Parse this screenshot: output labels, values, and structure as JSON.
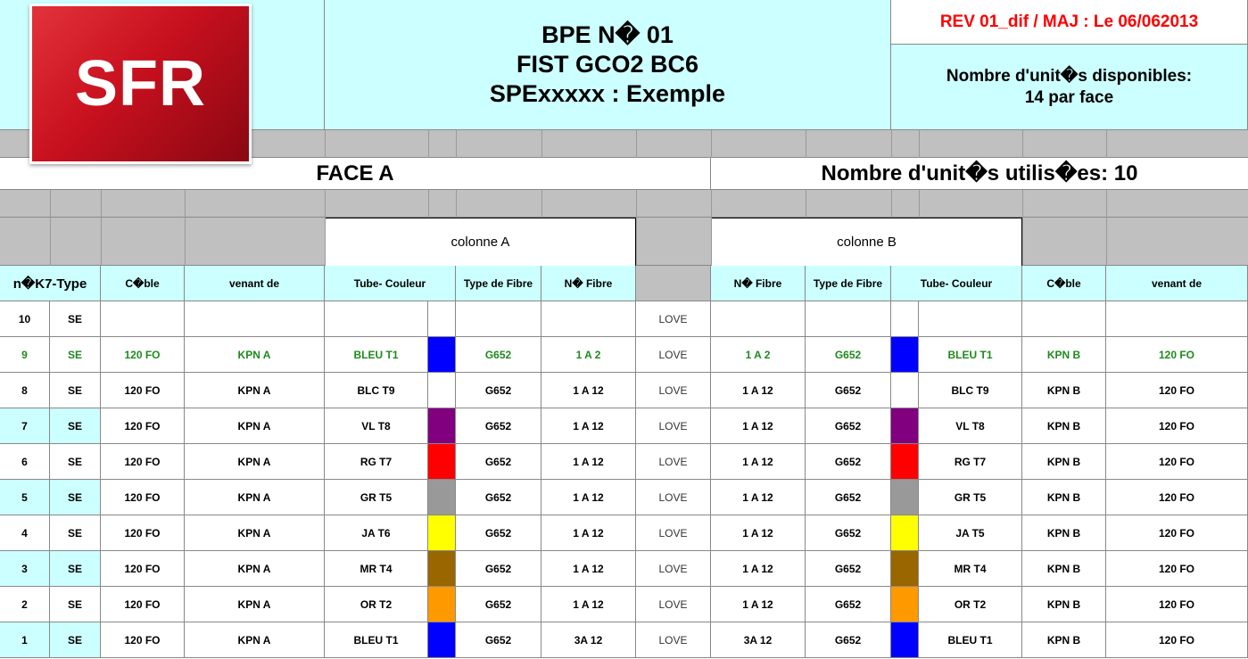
{
  "header": {
    "logo_text": "SFR",
    "title_lines": [
      "BPE N� 01",
      "FIST GCO2 BC6",
      "SPExxxxx : Exemple"
    ],
    "revision": "REV 01_dif / MAJ : Le 06/062013",
    "units_available_line1": "Nombre d'unit�s disponibles:",
    "units_available_line2": "14 par face",
    "face_label": "FACE A",
    "units_used": "Nombre d'unit�s utilis�es: 10",
    "colonne_a": "colonne A",
    "colonne_b": "colonne B"
  },
  "colors": {
    "cyan": "#ccffff",
    "gray": "#c0c0c0",
    "revision_red": "#ff0000",
    "highlight_green": "#1e8a1e"
  },
  "columns": {
    "k7_type": "n�K7-Type",
    "cable_a": "C�ble",
    "venant_a": "venant de",
    "tube_a": "Tube- Couleur",
    "type_fibre_a": "Type de Fibre",
    "n_fibre_a": "N� Fibre",
    "n_fibre_b": "N� Fibre",
    "type_fibre_b": "Type de Fibre",
    "tube_b": "Tube- Couleur",
    "cable_b": "C�ble",
    "venant_b": "venant de"
  },
  "rows": [
    {
      "n": "10",
      "type": "SE",
      "cable_a": "",
      "venant_a": "",
      "tube_a": "",
      "color_a": "#ffffff",
      "fibre_type_a": "",
      "fibre_a": "",
      "middle": "LOVE",
      "fibre_b": "",
      "fibre_type_b": "",
      "color_b": "#ffffff",
      "tube_b": "",
      "cable_b": "",
      "venant_b": "",
      "highlight": false,
      "cyan": false
    },
    {
      "n": "9",
      "type": "SE",
      "cable_a": "120 FO",
      "venant_a": "KPN A",
      "tube_a": "BLEU T1",
      "color_a": "#0000ff",
      "fibre_type_a": "G652",
      "fibre_a": "1 A 2",
      "middle": "LOVE",
      "fibre_b": "1 A 2",
      "fibre_type_b": "G652",
      "color_b": "#0000ff",
      "tube_b": "BLEU T1",
      "cable_b": "KPN B",
      "venant_b": "120 FO",
      "highlight": true,
      "cyan": false
    },
    {
      "n": "8",
      "type": "SE",
      "cable_a": "120 FO",
      "venant_a": "KPN A",
      "tube_a": "BLC T9",
      "color_a": "#ffffff",
      "fibre_type_a": "G652",
      "fibre_a": "1 A 12",
      "middle": "LOVE",
      "fibre_b": "1 A 12",
      "fibre_type_b": "G652",
      "color_b": "#ffffff",
      "tube_b": "BLC T9",
      "cable_b": "KPN B",
      "venant_b": "120 FO",
      "highlight": false,
      "cyan": false
    },
    {
      "n": "7",
      "type": "SE",
      "cable_a": "120 FO",
      "venant_a": "KPN A",
      "tube_a": "VL T8",
      "color_a": "#800080",
      "fibre_type_a": "G652",
      "fibre_a": "1 A 12",
      "middle": "LOVE",
      "fibre_b": "1 A 12",
      "fibre_type_b": "G652",
      "color_b": "#800080",
      "tube_b": "VL T8",
      "cable_b": "KPN B",
      "venant_b": "120 FO",
      "highlight": false,
      "cyan": true
    },
    {
      "n": "6",
      "type": "SE",
      "cable_a": "120 FO",
      "venant_a": "KPN A",
      "tube_a": "RG T7",
      "color_a": "#ff0000",
      "fibre_type_a": "G652",
      "fibre_a": "1 A 12",
      "middle": "LOVE",
      "fibre_b": "1 A 12",
      "fibre_type_b": "G652",
      "color_b": "#ff0000",
      "tube_b": "RG T7",
      "cable_b": "KPN B",
      "venant_b": "120 FO",
      "highlight": false,
      "cyan": false
    },
    {
      "n": "5",
      "type": "SE",
      "cable_a": "120 FO",
      "venant_a": "KPN A",
      "tube_a": "GR T5",
      "color_a": "#999999",
      "fibre_type_a": "G652",
      "fibre_a": "1 A 12",
      "middle": "LOVE",
      "fibre_b": "1 A 12",
      "fibre_type_b": "G652",
      "color_b": "#999999",
      "tube_b": "GR T5",
      "cable_b": "KPN B",
      "venant_b": "120 FO",
      "highlight": false,
      "cyan": true
    },
    {
      "n": "4",
      "type": "SE",
      "cable_a": "120 FO",
      "venant_a": "KPN A",
      "tube_a": "JA T6",
      "color_a": "#ffff00",
      "fibre_type_a": "G652",
      "fibre_a": "1 A 12",
      "middle": "LOVE",
      "fibre_b": "1 A 12",
      "fibre_type_b": "G652",
      "color_b": "#ffff00",
      "tube_b": "JA T5",
      "cable_b": "KPN B",
      "venant_b": "120 FO",
      "highlight": false,
      "cyan": false
    },
    {
      "n": "3",
      "type": "SE",
      "cable_a": "120 FO",
      "venant_a": "KPN A",
      "tube_a": "MR T4",
      "color_a": "#996600",
      "fibre_type_a": "G652",
      "fibre_a": "1 A 12",
      "middle": "LOVE",
      "fibre_b": "1 A 12",
      "fibre_type_b": "G652",
      "color_b": "#996600",
      "tube_b": "MR T4",
      "cable_b": "KPN B",
      "venant_b": "120 FO",
      "highlight": false,
      "cyan": true
    },
    {
      "n": "2",
      "type": "SE",
      "cable_a": "120 FO",
      "venant_a": "KPN A",
      "tube_a": "OR T2",
      "color_a": "#ff9900",
      "fibre_type_a": "G652",
      "fibre_a": "1 A 12",
      "middle": "LOVE",
      "fibre_b": "1 A 12",
      "fibre_type_b": "G652",
      "color_b": "#ff9900",
      "tube_b": "OR T2",
      "cable_b": "KPN B",
      "venant_b": "120 FO",
      "highlight": false,
      "cyan": false
    },
    {
      "n": "1",
      "type": "SE",
      "cable_a": "120 FO",
      "venant_a": "KPN A",
      "tube_a": "BLEU T1",
      "color_a": "#0000ff",
      "fibre_type_a": "G652",
      "fibre_a": "3A 12",
      "middle": "LOVE",
      "fibre_b": "3A 12",
      "fibre_type_b": "G652",
      "color_b": "#0000ff",
      "tube_b": "BLEU T1",
      "cable_b": "KPN B",
      "venant_b": "120 FO",
      "highlight": false,
      "cyan": true
    }
  ]
}
